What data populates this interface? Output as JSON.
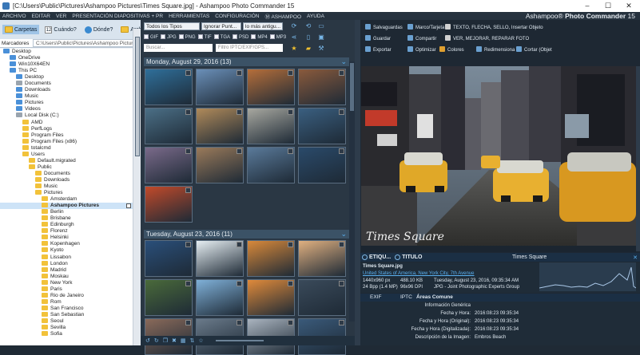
{
  "window": {
    "title": "[C:\\Users\\Public\\Pictures\\Ashampoo Pictures\\Times Square.jpg] - Ashampoo Photo Commander 15",
    "minimize": "–",
    "maximize": "☐",
    "close": "✕"
  },
  "menu": [
    "ARCHIVO",
    "EDITAR",
    "VER",
    "PRESENTACIÓN DIAPOSITIVAS + PR",
    "HERRAMIENTAS",
    "CONFIGURACIÓN",
    "Ⓜ ASHAMPOO",
    "AYUDA"
  ],
  "brand": {
    "prefix": "Ashampoo®",
    "name": "Photo Commander",
    "version": "15"
  },
  "left_toolbar": {
    "carpetas": "Carpetas",
    "cuando": "Cuándo?",
    "cuando_badge": "12",
    "donde": "Dónde?",
    "archivar": "Archivar"
  },
  "address": {
    "label": "Marcadores",
    "value": "C:\\Users\\Public\\Pictures\\Ashampoo Pictures"
  },
  "tree": [
    {
      "label": "Desktop",
      "indent": 0,
      "icon": "blue"
    },
    {
      "label": "OneDrive",
      "indent": 1,
      "icon": "blue"
    },
    {
      "label": "Win10X64EN",
      "indent": 1,
      "icon": "blue"
    },
    {
      "label": "This PC",
      "indent": 1,
      "icon": "blue"
    },
    {
      "label": "Desktop",
      "indent": 2,
      "icon": "blue"
    },
    {
      "label": "Documents",
      "indent": 2,
      "icon": "gray"
    },
    {
      "label": "Downloads",
      "indent": 2,
      "icon": "blue"
    },
    {
      "label": "Music",
      "indent": 2,
      "icon": "blue"
    },
    {
      "label": "Pictures",
      "indent": 2,
      "icon": "blue"
    },
    {
      "label": "Videos",
      "indent": 2,
      "icon": "blue"
    },
    {
      "label": "Local Disk (C:)",
      "indent": 2,
      "icon": "gray"
    },
    {
      "label": "AMD",
      "indent": 3,
      "icon": "folder"
    },
    {
      "label": "PerfLogs",
      "indent": 3,
      "icon": "folder"
    },
    {
      "label": "Program Files",
      "indent": 3,
      "icon": "folder"
    },
    {
      "label": "Program Files (x86)",
      "indent": 3,
      "icon": "folder"
    },
    {
      "label": "totalcmd",
      "indent": 3,
      "icon": "folder"
    },
    {
      "label": "Users",
      "indent": 3,
      "icon": "folder"
    },
    {
      "label": "Default.migrated",
      "indent": 4,
      "icon": "folder"
    },
    {
      "label": "Public",
      "indent": 4,
      "icon": "folder"
    },
    {
      "label": "Documents",
      "indent": 5,
      "icon": "folder"
    },
    {
      "label": "Downloads",
      "indent": 5,
      "icon": "folder"
    },
    {
      "label": "Music",
      "indent": 5,
      "icon": "folder"
    },
    {
      "label": "Pictures",
      "indent": 5,
      "icon": "folder"
    },
    {
      "label": "Amsterdam",
      "indent": 6,
      "icon": "folder"
    },
    {
      "label": "Ashampoo Pictures",
      "indent": 6,
      "icon": "folder",
      "selected": true
    },
    {
      "label": "Berlin",
      "indent": 6,
      "icon": "folder"
    },
    {
      "label": "Brisbane",
      "indent": 6,
      "icon": "folder"
    },
    {
      "label": "Edinburgh",
      "indent": 6,
      "icon": "folder"
    },
    {
      "label": "Florenz",
      "indent": 6,
      "icon": "folder"
    },
    {
      "label": "Helsinki",
      "indent": 6,
      "icon": "folder"
    },
    {
      "label": "Kopenhagen",
      "indent": 6,
      "icon": "folder"
    },
    {
      "label": "Kyoto",
      "indent": 6,
      "icon": "folder"
    },
    {
      "label": "Lissabon",
      "indent": 6,
      "icon": "folder"
    },
    {
      "label": "London",
      "indent": 6,
      "icon": "folder"
    },
    {
      "label": "Madrid",
      "indent": 6,
      "icon": "folder"
    },
    {
      "label": "Moskau",
      "indent": 6,
      "icon": "folder"
    },
    {
      "label": "New York",
      "indent": 6,
      "icon": "folder"
    },
    {
      "label": "Paris",
      "indent": 6,
      "icon": "folder"
    },
    {
      "label": "Rio de Janeiro",
      "indent": 6,
      "icon": "folder"
    },
    {
      "label": "Rom",
      "indent": 6,
      "icon": "folder"
    },
    {
      "label": "San Francisco",
      "indent": 6,
      "icon": "folder"
    },
    {
      "label": "San Sebastian",
      "indent": 6,
      "icon": "folder"
    },
    {
      "label": "Seoul",
      "indent": 6,
      "icon": "folder"
    },
    {
      "label": "Sevilla",
      "indent": 6,
      "icon": "folder"
    },
    {
      "label": "Sofia",
      "indent": 6,
      "icon": "folder"
    }
  ],
  "filters": {
    "type": "Todos los Tipos",
    "rating": "Ignorar Punt...",
    "sort": "lo más antigu...",
    "types": [
      "GIF",
      "JPG",
      "PNG",
      "TIF",
      "TGA",
      "PSD",
      "MP4",
      "MP3"
    ],
    "search_placeholder": "Buscar...",
    "iptc_placeholder": "Filtro IPTC/EXIF/GPS..."
  },
  "groups": [
    {
      "label": "Monday, August 29, 2016 (13)"
    },
    {
      "label": "Tuesday, August 23, 2016 (11)"
    }
  ],
  "thumb_colors": {
    "g1": [
      "#2f6f9a",
      "#6a8fb8",
      "#b56e3a",
      "#8a5a3c",
      "#4b6f86",
      "#b08a5a",
      "#a8a8a0",
      "#3a5f80",
      "#7a6a8a",
      "#9a7a5a",
      "#5a7a9a",
      "#2a4a6a",
      "#c24a2a"
    ],
    "g2": [
      "#2a4f7a",
      "#e6eef2",
      "#d9893a",
      "#e0b080",
      "#4a6a3a",
      "#7fb0d8",
      "#e08a3a",
      "#3a4a5a",
      "#8a6a5a",
      "#6a7a8a",
      "#aab4bf",
      "#3a5a7a"
    ]
  },
  "right_toolbar": {
    "row1": [
      {
        "label": "Salvaguardas",
        "icon": "#6aa0d0"
      },
      {
        "label": "Marco/Tarjeta",
        "icon": "#6aa0d0"
      },
      {
        "label": "TEXTO, FLECHA, SELLO, Insertar Objeto",
        "icon": "#d0d0d0"
      }
    ],
    "row2": [
      {
        "label": "Guardar",
        "icon": "#6aa0d0"
      },
      {
        "label": "Compartir",
        "icon": "#6aa0d0"
      },
      {
        "label": "VER, MEJORAR, REPARAR FOTO",
        "icon": "#d0d0d0"
      }
    ],
    "row3": [
      {
        "label": "Exportar",
        "icon": "#6aa0d0"
      },
      {
        "label": "Optimizar",
        "icon": "#6aa0d0"
      },
      {
        "label": "Colores",
        "icon": "#e0a030"
      },
      {
        "label": "Redimensiona",
        "icon": "#6aa0d0"
      },
      {
        "label": "Cortar (Objet",
        "icon": "#6aa0d0"
      }
    ]
  },
  "photo": {
    "caption": "Times Square"
  },
  "info": {
    "tab_etiq": "ETIQU...",
    "tab_titulo": "TITULO",
    "filename_center": "Times Square",
    "file": "Times Square.jpg",
    "location": "United States of America, New York City, 7th Avenue",
    "dims": "1440x960 px",
    "size_kb": "488.10 KB",
    "date": "Tuesday, August 23, 2016, 09:35:34 AM",
    "mp": "24 Bpp (1.4 MP)",
    "dpi": "96x96 DPI",
    "format": "JPG - Joint Photographic Experts Group"
  },
  "exif_tabs": [
    "EXIF",
    "IPTC",
    "Áreas Comune"
  ],
  "exif_rows": [
    {
      "k": "Información Genérica",
      "v": ""
    },
    {
      "k": "Fecha y Hora:",
      "v": "2016:08:23 09:35:34"
    },
    {
      "k": "Fecha y Hora (Original):",
      "v": "2016:08:23 09:35:34"
    },
    {
      "k": "Fecha y Hora (Digitalizada):",
      "v": "2016:08:23 09:35:34"
    },
    {
      "k": "Descripción de la Imagen:",
      "v": "Embros Beach"
    }
  ]
}
